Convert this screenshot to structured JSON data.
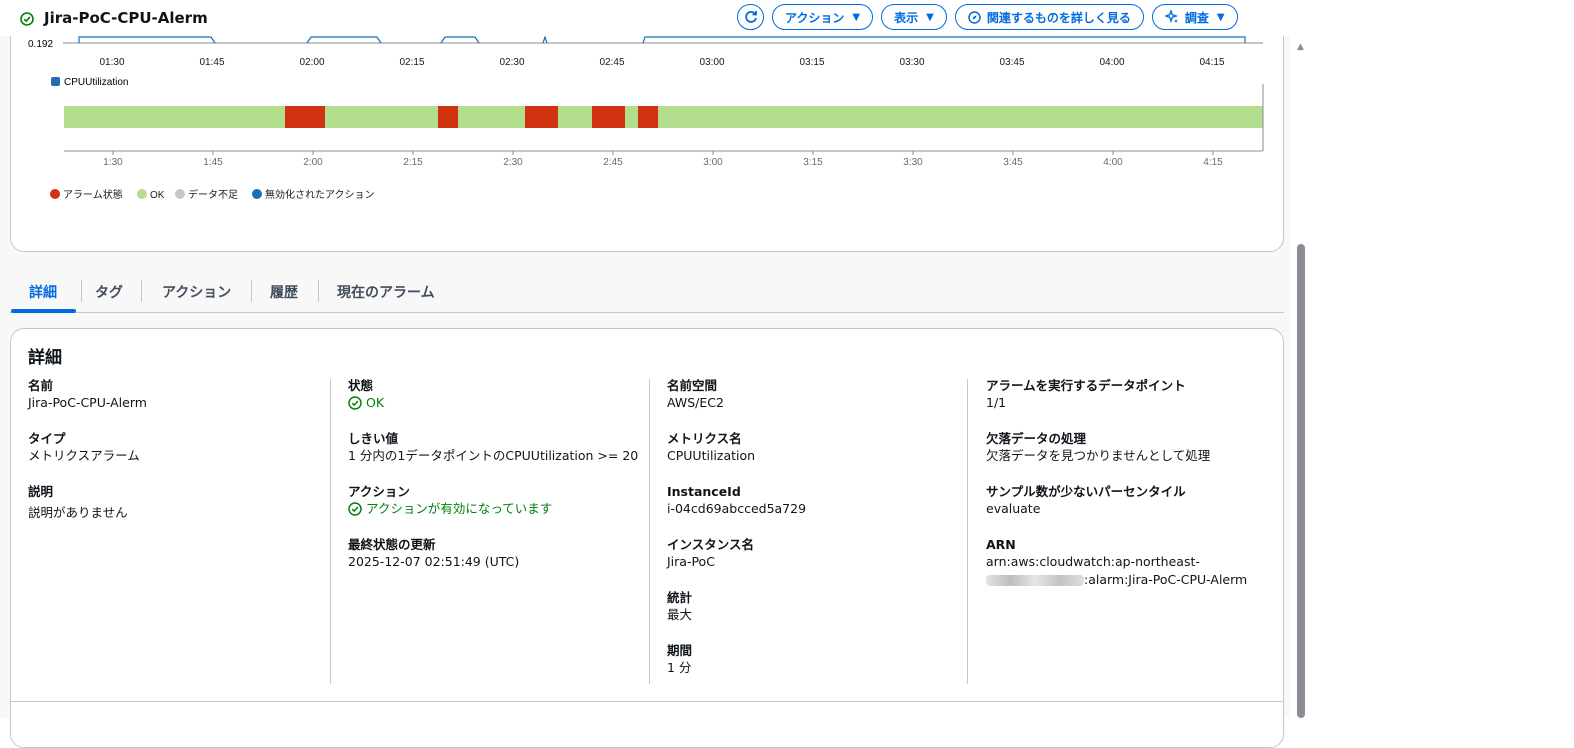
{
  "header": {
    "title": "Jira-PoC-CPU-Alerm",
    "buttons": {
      "actions": "アクション",
      "view": "表示",
      "explore_related": "関連するものを詳しく見る",
      "investigate": "調査"
    }
  },
  "metric_chart": {
    "y_tick": "0.192",
    "x_ticks": [
      "01:30",
      "01:45",
      "02:00",
      "02:15",
      "02:30",
      "02:45",
      "03:00",
      "03:15",
      "03:30",
      "03:45",
      "04:00",
      "04:15"
    ],
    "legend": "CPUUtilization"
  },
  "state_timeline": {
    "x_ticks": [
      "1:30",
      "1:45",
      "2:00",
      "2:15",
      "2:30",
      "2:45",
      "3:00",
      "3:15",
      "3:30",
      "3:45",
      "4:00",
      "4:15"
    ],
    "legend": [
      {
        "label": "アラーム状態",
        "color": "#d13212"
      },
      {
        "label": "OK",
        "color": "#b2de8e"
      },
      {
        "label": "データ不足",
        "color": "#c6c6c6"
      },
      {
        "label": "無効化されたアクション",
        "color": "#1f6fb5"
      }
    ],
    "colors": {
      "ok": "#b2de8e",
      "alarm": "#d13212"
    }
  },
  "tabs": [
    "詳細",
    "タグ",
    "アクション",
    "履歴",
    "現在のアラーム"
  ],
  "details": {
    "title": "詳細",
    "col1": {
      "name_label": "名前",
      "name": "Jira-PoC-CPU-Alerm",
      "type_label": "タイプ",
      "type": "メトリクスアラーム",
      "desc_label": "説明",
      "desc": "説明がありません"
    },
    "col2": {
      "state_label": "状態",
      "state": "OK",
      "threshold_label": "しきい値",
      "threshold": "1 分内の1データポイントのCPUUtilization >= 20",
      "actions_label": "アクション",
      "actions": "アクションが有効になっています",
      "last_update_label": "最終状態の更新",
      "last_update": "2025-12-07 02:51:49 (UTC)"
    },
    "col3": {
      "namespace_label": "名前空間",
      "namespace": "AWS/EC2",
      "metric_label": "メトリクス名",
      "metric": "CPUUtilization",
      "instance_id_label": "InstanceId",
      "instance_id": "i-04cd69abcced5a729",
      "instance_name_label": "インスタンス名",
      "instance_name": "Jira-PoC",
      "stat_label": "統計",
      "stat": "最大",
      "period_label": "期間",
      "period": "1 分"
    },
    "col4": {
      "datapoints_label": "アラームを実行するデータポイント",
      "datapoints": "1/1",
      "missing_label": "欠落データの処理",
      "missing": "欠落データを見つかりませんとして処理",
      "percentile_label": "サンプル数が少ないパーセンタイル",
      "percentile": "evaluate",
      "arn_label": "ARN",
      "arn_line1": "arn:aws:cloudwatch:ap-northeast-",
      "arn_line2": ":alarm:Jira-PoC-CPU-Alerm"
    }
  },
  "colors": {
    "accent": "#006ce0",
    "ok_green": "#037f0c"
  }
}
